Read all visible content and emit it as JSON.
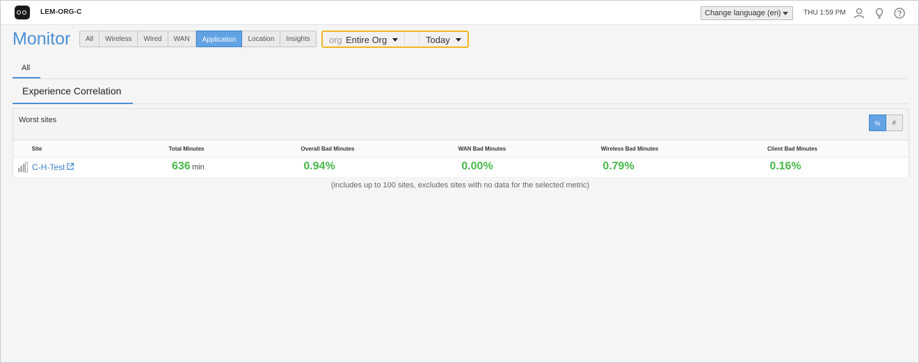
{
  "header": {
    "org_name": "LEM-ORG-C",
    "language_select": "Change language (en)",
    "clock": "THU 1:59 PM",
    "icons": [
      "user-icon",
      "lightbulb-icon",
      "help-icon"
    ]
  },
  "page": {
    "title": "Monitor",
    "nav": [
      "All",
      "Wireless",
      "Wired",
      "WAN",
      "Application",
      "Location",
      "Insights"
    ],
    "active_nav": "Application",
    "scope_label": "org",
    "scope_value": "Entire Org",
    "time_range": "Today"
  },
  "tabs": {
    "primary": "All",
    "secondary": "Experience Correlation"
  },
  "panel": {
    "title": "Worst sites",
    "toggle": [
      "%",
      "#"
    ],
    "active_toggle": "%",
    "columns": [
      "Site",
      "Total Minutes",
      "Overall Bad Minutes",
      "WAN Bad Minutes",
      "Wireless Bad Minutes",
      "Client Bad Minutes"
    ],
    "rows": [
      {
        "site": "C-H-Test",
        "total_minutes": "636",
        "total_unit": "min",
        "overall_bad": "0.94%",
        "wan_bad": "0.00%",
        "wireless_bad": "0.79%",
        "client_bad": "0.16%"
      }
    ],
    "footnote": "(includes up to 100 sites, excludes sites with no data for the selected metric)"
  },
  "colors": {
    "accent": "#4a8fd6",
    "active_button": "#63a3e4",
    "highlight_border": "#f0b51e",
    "good_value": "#48b84a"
  }
}
